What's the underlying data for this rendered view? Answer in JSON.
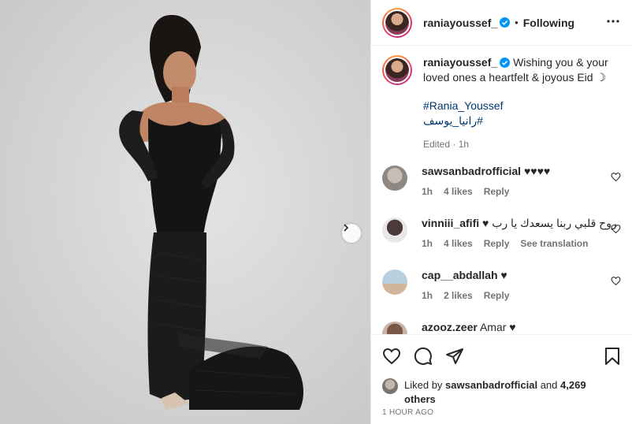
{
  "post": {
    "username": "raniayoussef_",
    "dot": "•",
    "following_label": "Following",
    "more_icon": "more-horizontal-icon"
  },
  "caption": {
    "username": "raniayoussef_",
    "text_line1": "Wishing you & your",
    "text_line2": "loved ones a heartfelt & joyous Eid ☽",
    "tag1": "#Rania_Youssef",
    "tag2": "#رانيا_يوسف",
    "edited": "Edited",
    "edited_sep": " · ",
    "edited_time": "1h"
  },
  "comments": [
    {
      "user": "sawsanbadrofficial",
      "text": "♥♥♥♥",
      "time": "1h",
      "likes": "4 likes",
      "reply": "Reply",
      "extra": ""
    },
    {
      "user": "vinniii_afifi",
      "text": "روح قلبي ربنا يسعدك يا رب ♥",
      "time": "1h",
      "likes": "4 likes",
      "reply": "Reply",
      "extra": "See translation"
    },
    {
      "user": "cap__abdallah",
      "text": "♥",
      "time": "1h",
      "likes": "2 likes",
      "reply": "Reply",
      "extra": ""
    },
    {
      "user": "azooz.zeer",
      "text": "Amar ♥",
      "time": "",
      "likes": "",
      "reply": "",
      "extra": ""
    }
  ],
  "likes": {
    "prefix": "Liked by ",
    "user": "sawsanbadrofficial",
    "middle": " and ",
    "count": "4,269",
    "suffix": "others"
  },
  "timestamp": "1 HOUR AGO",
  "colors": {
    "hashtag": "#00376b",
    "verified": "#0095f6",
    "muted": "#737373"
  }
}
